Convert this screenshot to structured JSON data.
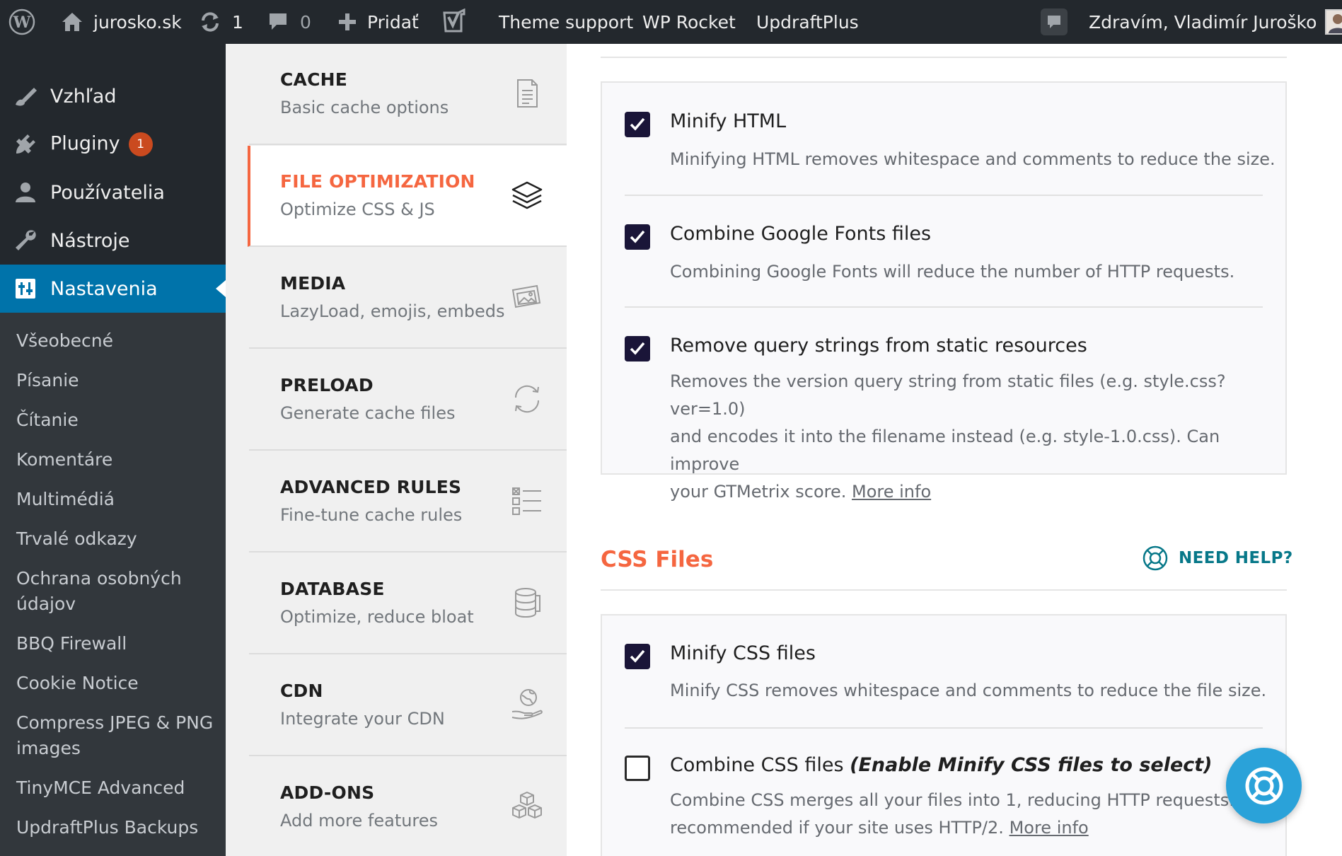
{
  "adminbar": {
    "site_name": "jurosko.sk",
    "updates_count": "1",
    "comments_count": "0",
    "new_label": "Pridať",
    "theme_support": "Theme support",
    "wp_rocket": "WP Rocket",
    "updraftplus": "UpdraftPlus",
    "greeting": "Zdravím, Vladimír Juroško"
  },
  "menu": {
    "appearance": "Vzhľad",
    "plugins": "Pluginy",
    "plugins_badge": "1",
    "users": "Používatelia",
    "tools": "Nástroje",
    "settings": "Nastavenia",
    "submenu": [
      "Všeobecné",
      "Písanie",
      "Čítanie",
      "Komentáre",
      "Multimédiá",
      "Trvalé odkazy",
      "Ochrana osobných údajov",
      "BBQ Firewall",
      "Cookie Notice",
      "Compress JPEG & PNG images",
      "TinyMCE Advanced",
      "UpdraftPlus Backups"
    ]
  },
  "rocket_nav": [
    {
      "title": "CACHE",
      "subtitle": "Basic cache options",
      "icon": "document-icon"
    },
    {
      "title": "FILE OPTIMIZATION",
      "subtitle": "Optimize CSS & JS",
      "icon": "layers-icon"
    },
    {
      "title": "MEDIA",
      "subtitle": "LazyLoad, emojis, embeds",
      "icon": "images-icon"
    },
    {
      "title": "PRELOAD",
      "subtitle": "Generate cache files",
      "icon": "refresh-icon"
    },
    {
      "title": "ADVANCED RULES",
      "subtitle": "Fine-tune cache rules",
      "icon": "checklist-icon"
    },
    {
      "title": "DATABASE",
      "subtitle": "Optimize, reduce bloat",
      "icon": "database-icon"
    },
    {
      "title": "CDN",
      "subtitle": "Integrate your CDN",
      "icon": "globe-hand-icon"
    },
    {
      "title": "ADD-ONS",
      "subtitle": "Add more features",
      "icon": "cubes-icon"
    }
  ],
  "basic_settings": {
    "minify_html": {
      "label": "Minify HTML",
      "desc": "Minifying HTML removes whitespace and comments to reduce the size.",
      "checked": true
    },
    "combine_google_fonts": {
      "label": "Combine Google Fonts files",
      "desc": "Combining Google Fonts will reduce the number of HTTP requests.",
      "checked": true
    },
    "remove_query_strings": {
      "label": "Remove query strings from static resources",
      "desc_line1": "Removes the version query string from static files (e.g. style.css?ver=1.0)",
      "desc_line2": "and encodes it into the filename instead (e.g. style-1.0.css). Can improve",
      "desc_line3": "your GTMetrix score.",
      "link": "More info",
      "checked": true
    }
  },
  "css_section": {
    "title": "CSS Files",
    "need_help": "NEED HELP?",
    "minify_css": {
      "label": "Minify CSS files",
      "desc": "Minify CSS removes whitespace and comments to reduce the file size.",
      "checked": true
    },
    "combine_css": {
      "label": "Combine CSS files",
      "label_note": "(Enable Minify CSS files to select)",
      "desc_line1": "Combine CSS merges all your files into 1, reducing HTTP requests. Not",
      "desc_line2": "recommended if your site uses HTTP/2.",
      "link": "More info",
      "checked": false
    }
  },
  "colors": {
    "accent": "#f56640",
    "wp_blue": "#0073aa",
    "checkbox": "#1a1538",
    "help_teal": "#077889",
    "fab": "#2aa2d9"
  }
}
